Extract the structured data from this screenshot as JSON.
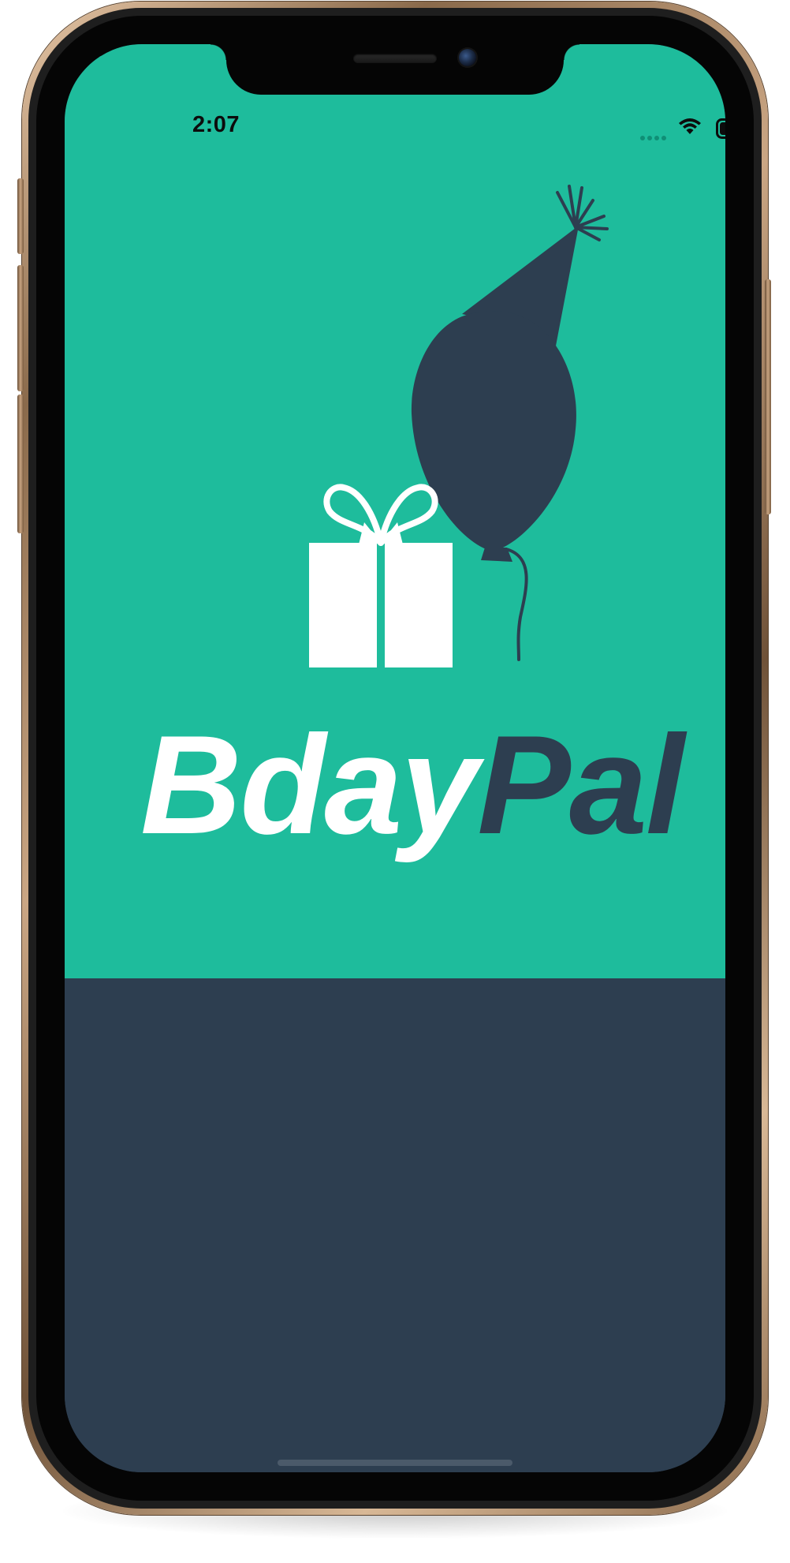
{
  "status_bar": {
    "time": "2:07",
    "wifi_icon": "wifi-icon",
    "battery_icon": "battery-icon"
  },
  "app": {
    "name_part1": "Bday",
    "name_part2": "Pal"
  },
  "colors": {
    "accent_teal": "#1ebc9c",
    "navy": "#2d3e50",
    "white": "#ffffff"
  },
  "icons": {
    "gift": "gift-icon",
    "balloon": "balloon-icon",
    "party_hat": "party-hat-icon"
  }
}
